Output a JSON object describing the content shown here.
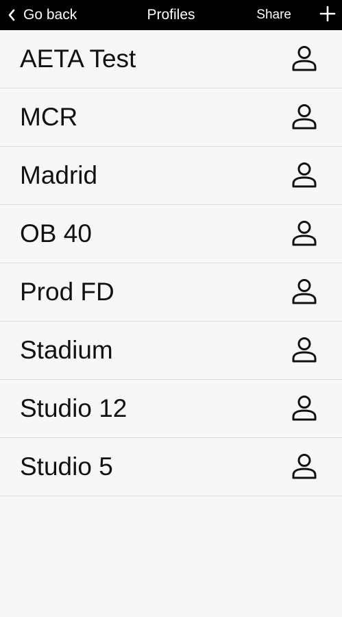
{
  "topbar": {
    "back_label": "Go back",
    "title": "Profiles",
    "share_label": "Share",
    "back_icon": "chevron-left-icon",
    "add_icon": "plus-icon",
    "background_color": "#000000",
    "text_color": "#ffffff"
  },
  "profiles": [
    {
      "name": "AETA Test",
      "icon": "person-icon"
    },
    {
      "name": "MCR",
      "icon": "person-icon"
    },
    {
      "name": "Madrid",
      "icon": "person-icon"
    },
    {
      "name": "OB 40",
      "icon": "person-icon"
    },
    {
      "name": "Prod FD",
      "icon": "person-icon"
    },
    {
      "name": "Stadium",
      "icon": "person-icon"
    },
    {
      "name": "Studio 12",
      "icon": "person-icon"
    },
    {
      "name": "Studio 5",
      "icon": "person-icon"
    }
  ]
}
